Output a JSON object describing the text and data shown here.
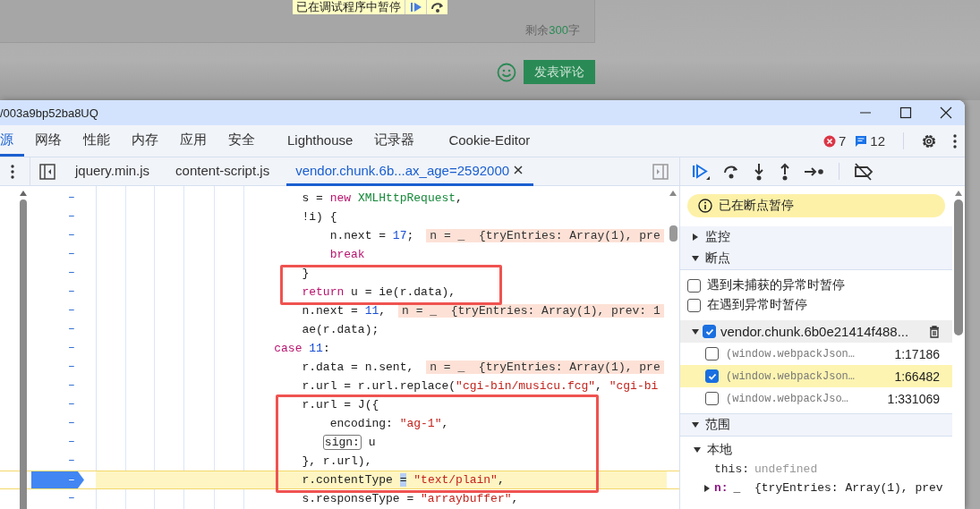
{
  "page": {
    "debug_banner": "已在调试程序中暂停",
    "remaining_prefix": "剩余",
    "remaining_count": "300",
    "remaining_suffix": "字",
    "submit": "发表评论"
  },
  "window": {
    "title": "/003a9bp52ba8UQ"
  },
  "tabs": [
    {
      "label": "源",
      "selected": true
    },
    {
      "label": "网络",
      "selected": false
    },
    {
      "label": "性能",
      "selected": false
    },
    {
      "label": "内存",
      "selected": false
    },
    {
      "label": "应用",
      "selected": false
    },
    {
      "label": "安全",
      "selected": false
    },
    {
      "label": "Lighthouse",
      "selected": false
    },
    {
      "label": "记录器",
      "selected": false
    },
    {
      "label": "Cookie-Editor",
      "selected": false
    }
  ],
  "errors": "7",
  "messages": "12",
  "file_tabs": [
    {
      "label": "jquery.min.js",
      "selected": false
    },
    {
      "label": "content-script.js",
      "selected": false
    },
    {
      "label": "vendor.chunk.6b...ax_age=2592000",
      "selected": true
    }
  ],
  "code": [
    {
      "gutter": "–",
      "current": false,
      "breakpoint": false,
      "tokens": [
        {
          "kind": "plain",
          "text": "                            s = "
        },
        {
          "kind": "keyword",
          "text": "new"
        },
        {
          "kind": "class",
          "text": " XMLHttpRequest"
        },
        {
          "kind": "plain",
          "text": ","
        }
      ]
    },
    {
      "gutter": "–",
      "current": false,
      "breakpoint": false,
      "tokens": [
        {
          "kind": "plain",
          "text": "                            !i) {"
        }
      ]
    },
    {
      "gutter": "–",
      "current": false,
      "breakpoint": false,
      "tokens": [
        {
          "kind": "plain",
          "text": "                                n.next = "
        },
        {
          "kind": "number",
          "text": "17"
        },
        {
          "kind": "plain",
          "text": ";"
        },
        {
          "kind": "value",
          "text": "n = _  {tryEntries: Array(1), pre"
        }
      ]
    },
    {
      "gutter": "–",
      "current": false,
      "breakpoint": false,
      "tokens": [
        {
          "kind": "keyword",
          "text": "                                break"
        }
      ]
    },
    {
      "gutter": "–",
      "current": false,
      "breakpoint": false,
      "tokens": [
        {
          "kind": "plain",
          "text": "                            }"
        }
      ]
    },
    {
      "gutter": "–",
      "current": false,
      "breakpoint": false,
      "tokens": [
        {
          "kind": "keyword",
          "text": "                            return"
        },
        {
          "kind": "plain",
          "text": " u = ie(r.data),"
        }
      ]
    },
    {
      "gutter": "–",
      "current": false,
      "breakpoint": false,
      "tokens": [
        {
          "kind": "plain",
          "text": "                            n.next = "
        },
        {
          "kind": "number",
          "text": "11"
        },
        {
          "kind": "plain",
          "text": ","
        },
        {
          "kind": "value",
          "text": "n = _  {tryEntries: Array(1), prev: 1"
        }
      ]
    },
    {
      "gutter": "–",
      "current": false,
      "breakpoint": false,
      "tokens": [
        {
          "kind": "plain",
          "text": "                            ae(r.data);"
        }
      ]
    },
    {
      "gutter": "–",
      "current": false,
      "breakpoint": false,
      "tokens": [
        {
          "kind": "keyword",
          "text": "                        case"
        },
        {
          "kind": "number",
          "text": " 11"
        },
        {
          "kind": "plain",
          "text": ":"
        }
      ]
    },
    {
      "gutter": "–",
      "current": false,
      "breakpoint": false,
      "tokens": [
        {
          "kind": "plain",
          "text": "                            r.data = n.sent,"
        },
        {
          "kind": "value",
          "text": "n = _  {tryEntries: Array(1), pre"
        }
      ]
    },
    {
      "gutter": "–",
      "current": false,
      "breakpoint": false,
      "tokens": [
        {
          "kind": "plain",
          "text": "                            r.url = r.url.replace("
        },
        {
          "kind": "string",
          "text": "\"cgi-bin/musicu.fcg\""
        },
        {
          "kind": "plain",
          "text": ", "
        },
        {
          "kind": "string",
          "text": "\"cgi-bi"
        }
      ]
    },
    {
      "gutter": "–",
      "current": false,
      "breakpoint": false,
      "tokens": [
        {
          "kind": "plain",
          "text": "                            r.url = J({"
        }
      ]
    },
    {
      "gutter": "–",
      "current": false,
      "breakpoint": false,
      "tokens": [
        {
          "kind": "plain",
          "text": "                                encoding: "
        },
        {
          "kind": "string",
          "text": "\"ag-1\""
        },
        {
          "kind": "plain",
          "text": ","
        }
      ]
    },
    {
      "gutter": "–",
      "current": false,
      "breakpoint": false,
      "tokens": [
        {
          "kind": "label",
          "text": "                               sign:"
        },
        {
          "kind": "plain",
          "text": " u"
        }
      ]
    },
    {
      "gutter": "–",
      "current": false,
      "breakpoint": false,
      "tokens": [
        {
          "kind": "plain",
          "text": "                            }, r.url),"
        }
      ]
    },
    {
      "gutter": "–",
      "current": true,
      "breakpoint": true,
      "tokens": [
        {
          "kind": "plain",
          "text": "                            r.contentType "
        },
        {
          "kind": "cursor",
          "text": "="
        },
        {
          "kind": "string",
          "text": " \"text/plain\""
        },
        {
          "kind": "plain",
          "text": ","
        }
      ]
    },
    {
      "gutter": "–",
      "current": false,
      "breakpoint": false,
      "tokens": [
        {
          "kind": "plain",
          "text": "                            s.responseType = "
        },
        {
          "kind": "string",
          "text": "\"arraybuffer\""
        },
        {
          "kind": "plain",
          "text": ","
        }
      ]
    }
  ],
  "debugger": {
    "status": "已在断点暂停",
    "watch": {
      "title": "监控",
      "expanded": false
    },
    "breakpoints": {
      "title": "断点",
      "expanded": true,
      "options": [
        {
          "label": "遇到未捕获的异常时暂停",
          "checked": false
        },
        {
          "label": "在遇到异常时暂停",
          "checked": false
        }
      ],
      "file": {
        "name": "vendor.chunk.6b0e21414f488...",
        "checked": true,
        "expanded": true
      },
      "items": [
        {
          "text": "(window.webpackJson…",
          "location": "1:17186",
          "checked": false,
          "selected": false
        },
        {
          "text": "(window.webpackJson…",
          "location": "1:66482",
          "checked": true,
          "selected": true
        },
        {
          "text": "(window.webpackJso…",
          "location": "1:331069",
          "checked": false,
          "selected": false
        }
      ]
    },
    "scope": {
      "title": "范围",
      "expanded": true,
      "groups": [
        {
          "title": "本地",
          "expanded": true,
          "entries": [
            {
              "kind": "primitive",
              "name": "this:",
              "value": "undefined"
            },
            {
              "kind": "object",
              "name": "n:",
              "value": "_  {tryEntries: Array(1), prev",
              "expanded": false
            }
          ]
        }
      ]
    }
  }
}
